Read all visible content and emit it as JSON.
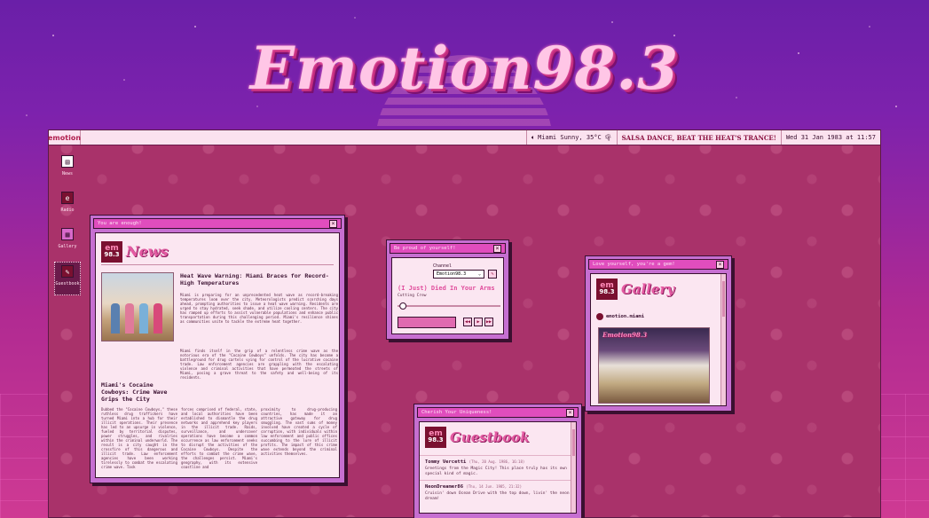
{
  "site": {
    "title": "Emotion98.3"
  },
  "taskbar": {
    "logo": "emotion",
    "weather": "Miami Sunny, 35°C",
    "news": "SALSA DANCE, BEAT THE HEAT'S TRANCE!",
    "datetime": "Wed 31 Jan 1983 at 11:57",
    "icons": [
      "speaker-icon",
      "palm-tree-icon"
    ]
  },
  "sidebar": {
    "items": [
      {
        "label": "News",
        "icon": "newspaper-icon"
      },
      {
        "label": "Radio",
        "icon": "radio-icon"
      },
      {
        "label": "Gallery",
        "icon": "gallery-icon"
      },
      {
        "label": "Guestbook",
        "icon": "guestbook-icon"
      }
    ]
  },
  "brand": {
    "letters": "em",
    "freq": "98.3"
  },
  "news_window": {
    "title": "You are enough!",
    "heading": "News",
    "article1": {
      "headline": "Heat Wave Warning: Miami Braces for Record-High Temperatures",
      "body": "Miami is preparing for an unprecedented heat wave as record-breaking temperatures loom over the city. Meteorologists predict scorching days ahead, prompting authorities to issue a heat wave warning. Residents are urged to stay hydrated, seek shade, and utilize cooling centers. The city has ramped up efforts to assist vulnerable populations and enhance public transportation during this challenging period. Miami's resilience shines as communities unite to tackle the extreme heat together."
    },
    "article2": {
      "headline": "Miami's Cocaine Cowboys: Crime Wave Grips the City",
      "intro": "Miami finds itself in the grip of a relentless crime wave as the notorious era of the \"Cocaine Cowboys\" unfolds. The city has become a battleground for drug cartels vying for control of the lucrative cocaine trade. Law enforcement agencies are grappling with the escalating violence and criminal activities that have permeated the streets of Miami, posing a grave threat to the safety and well-being of its residents.",
      "col1": "Dubbed the \"Cocaine Cowboys,\" these ruthless drug traffickers have turned Miami into a hub for their illicit operations. Their presence has led to an upsurge in violence, fueled by territorial disputes, power struggles, and rivalries within the criminal underworld. The result is a city caught in the crossfire of this dangerous and illicit trade. Law enforcement agencies have been working tirelessly to combat the escalating crime wave. Task",
      "col2": "forces comprised of federal, state, and local authorities have been established to dismantle the drug networks and apprehend key players in the illicit trade. Raids, surveillance, and undercover operations have become a common occurrence as law enforcement seeks to disrupt the activities of the Cocaine Cowboys. Despite the efforts to combat the crime wave, the challenges persist. Miami's geography, with its extensive coastline and",
      "col3": "proximity to drug-producing countries, has made it an attractive gateway for drug smuggling. The vast sums of money involved have created a cycle of corruption, with individuals within law enforcement and public offices succumbing to the lure of illicit profits. The impact of this crime wave extends beyond the criminal activities themselves."
    }
  },
  "radio_window": {
    "title": "Be proud of yourself!",
    "channel_label": "Channel",
    "channel_value": "Emotion98.3",
    "song": "(I Just) Died In Your Arms",
    "artist": "Cutting Crew",
    "volume_fraction": 0.02,
    "buttons": [
      "◀◀",
      "▶",
      "▶▶"
    ]
  },
  "gallery_window": {
    "title": "Love yourself, you're a gem!",
    "heading": "Gallery",
    "account": "emotion.miami",
    "photo_caption": "Emotion98.3"
  },
  "guestbook_window": {
    "title": "Cherish Your Uniqueness!",
    "heading": "Guestbook",
    "entries": [
      {
        "name": "Tommy Vercetti",
        "date": "(Thu, 20 Aug. 1986, 16:18)",
        "message": "Greetings from the Magic City! This place truly has its own special kind of magic."
      },
      {
        "name": "NeonDreamer86",
        "date": "(Thu, 14 Jun. 1985, 21:32)",
        "message": "Cruisin' down Ocean Drive with the top down, livin' the neon dream!"
      }
    ]
  }
}
